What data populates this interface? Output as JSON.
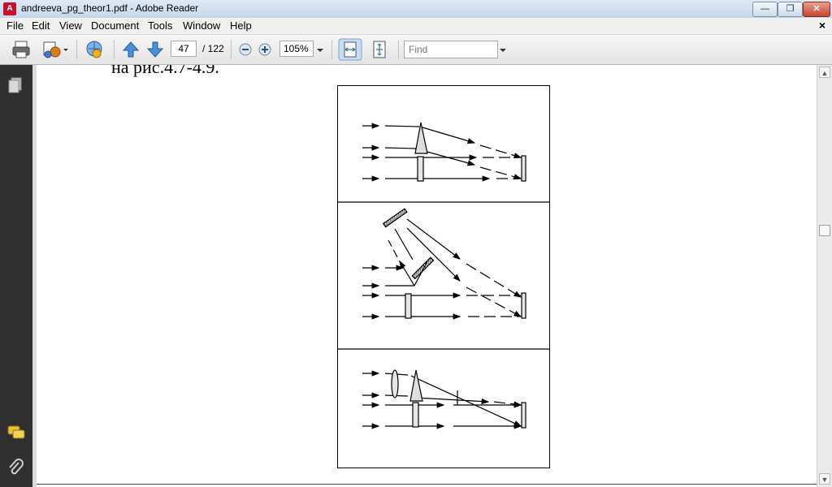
{
  "window": {
    "title": "andreeva_pg_theor1.pdf - Adobe Reader",
    "app_icon_glyph": "A",
    "buttons": {
      "minimize": "—",
      "maximize": "❐",
      "close": "✕"
    }
  },
  "menu": {
    "items": [
      "File",
      "Edit",
      "View",
      "Document",
      "Tools",
      "Window",
      "Help"
    ],
    "close_glyph": "×"
  },
  "toolbar": {
    "current_page": "47",
    "total_pages": "/ 122",
    "zoom": "105%",
    "find_placeholder": "Find",
    "icons": [
      "print-icon",
      "export-icon",
      "collaborate-icon",
      "previous-page-icon",
      "next-page-icon",
      "zoom-out-icon",
      "zoom-in-icon",
      "fit-width-icon",
      "fit-page-icon"
    ]
  },
  "sidebar": {
    "icons": [
      "pages-icon",
      "comments-icon",
      "attachments-icon"
    ]
  },
  "document": {
    "caption": "на рис.4.7-4.9."
  }
}
